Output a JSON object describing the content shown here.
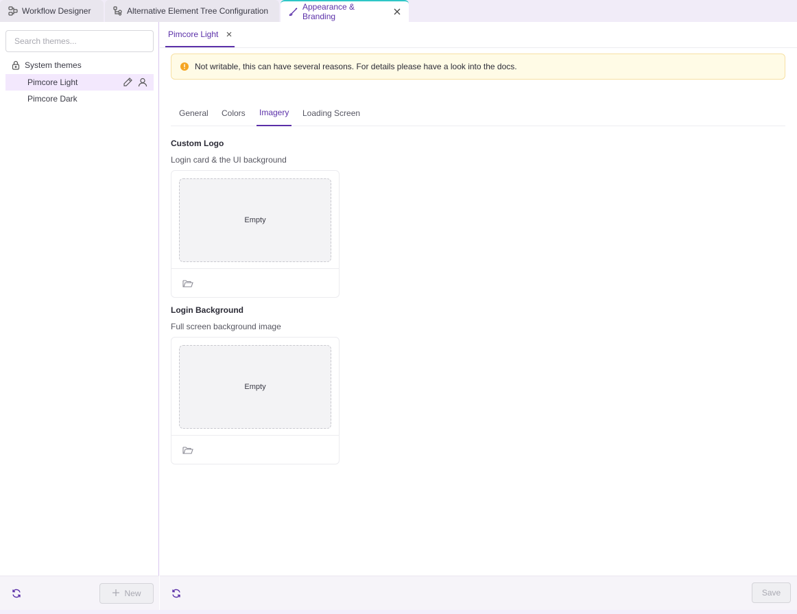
{
  "top_tabs": [
    {
      "label": "Workflow Designer",
      "icon": "workflow-icon"
    },
    {
      "label": "Alternative Element Tree Configuration",
      "icon": "tree-config-icon"
    },
    {
      "label": "Appearance & Branding",
      "icon": "brush-icon",
      "active": true
    }
  ],
  "sidebar": {
    "search_placeholder": "Search themes...",
    "group_label": "System themes",
    "items": [
      {
        "label": "Pimcore Light",
        "selected": true
      },
      {
        "label": "Pimcore Dark"
      }
    ],
    "new_label": "New"
  },
  "editor": {
    "tab_label": "Pimcore Light",
    "warning": "Not writable, this can have several reasons. For details please have a look into the docs.",
    "tabs": [
      "General",
      "Colors",
      "Imagery",
      "Loading Screen"
    ],
    "active_tab": "Imagery",
    "sections": [
      {
        "title": "Custom Logo",
        "description": "Login card & the UI background",
        "empty_label": "Empty"
      },
      {
        "title": "Login Background",
        "description": "Full screen background image",
        "empty_label": "Empty"
      }
    ],
    "save_label": "Save"
  },
  "colors": {
    "accent": "#5a2fa8",
    "tab_indicator": "#2fc6c6",
    "warning_bg": "#fffbe6",
    "warning_icon": "#f5a623"
  }
}
